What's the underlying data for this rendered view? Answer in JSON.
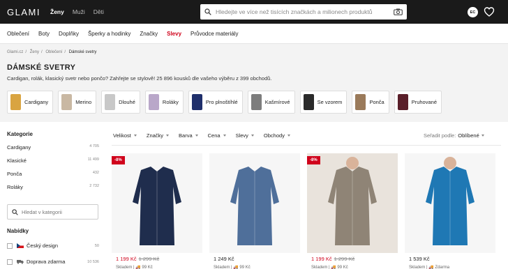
{
  "header": {
    "logo": "GLAMI",
    "nav": [
      {
        "label": "Ženy",
        "active": true
      },
      {
        "label": "Muži",
        "active": false
      },
      {
        "label": "Děti",
        "active": false
      }
    ],
    "search_placeholder": "Hledejte ve více než tisících značkách a milionech produktů",
    "user_initials": "EC"
  },
  "category_nav": [
    {
      "label": "Oblečení",
      "sale": false
    },
    {
      "label": "Boty",
      "sale": false
    },
    {
      "label": "Doplňky",
      "sale": false
    },
    {
      "label": "Šperky a hodinky",
      "sale": false
    },
    {
      "label": "Značky",
      "sale": false
    },
    {
      "label": "Slevy",
      "sale": true
    },
    {
      "label": "Průvodce materiály",
      "sale": false
    }
  ],
  "breadcrumb": [
    "Glami.cz",
    "Ženy",
    "Oblečení",
    "Dámské svetry"
  ],
  "page_title": "DÁMSKÉ SVETRY",
  "page_description": "Cardigan, rolák, klasický svetr nebo pončo? Zahřejte se stylově! 25 896 kousků dle vašeho výběru z 399 obchodů.",
  "chips": [
    {
      "label": "Cardigany",
      "color": "#d9a441"
    },
    {
      "label": "Merino",
      "color": "#c9b8a3"
    },
    {
      "label": "Dlouhé",
      "color": "#c8c8c8"
    },
    {
      "label": "Roláky",
      "color": "#b9a7c9"
    },
    {
      "label": "Pro plnoštíhlé",
      "color": "#1f2f6b"
    },
    {
      "label": "Kašmírové",
      "color": "#7d7d7d"
    },
    {
      "label": "Se vzorem",
      "color": "#2a2a2a"
    },
    {
      "label": "Ponča",
      "color": "#9a7a5a"
    },
    {
      "label": "Pruhované",
      "color": "#5a1f2a"
    }
  ],
  "sidebar": {
    "categories_title": "Kategorie",
    "categories": [
      {
        "label": "Cardigany",
        "count": "4 705"
      },
      {
        "label": "Klasické",
        "count": "11 499"
      },
      {
        "label": "Ponča",
        "count": "432"
      },
      {
        "label": "Roláky",
        "count": "2 732"
      }
    ],
    "category_search_placeholder": "Hledat v kategorii",
    "offers_title": "Nabídky",
    "offers": [
      {
        "label": "Český design",
        "count": "50"
      },
      {
        "label": "Doprava zdarma",
        "count": "10 536"
      }
    ]
  },
  "filters": [
    "Velikost",
    "Značky",
    "Barva",
    "Cena",
    "Slevy",
    "Obchody"
  ],
  "sort": {
    "label": "Seřadit podle:",
    "value": "Oblíbené"
  },
  "products": [
    {
      "badge": "-8%",
      "price": "1 199 Kč",
      "old_price": "1 299 Kč",
      "stock": "Skladem",
      "shipping": "99 Kč",
      "color": "#1f2d4d"
    },
    {
      "badge": "",
      "price": "1 249 Kč",
      "old_price": "",
      "stock": "Skladem",
      "shipping": "99 Kč",
      "color": "#4f6f9a"
    },
    {
      "badge": "-8%",
      "price": "1 199 Kč",
      "old_price": "1 299 Kč",
      "stock": "Skladem",
      "shipping": "99 Kč",
      "color": "#8f8476"
    },
    {
      "badge": "",
      "price": "1 539 Kč",
      "old_price": "",
      "stock": "Skladem",
      "shipping": "Zdarma",
      "color": "#1f78b4"
    }
  ]
}
